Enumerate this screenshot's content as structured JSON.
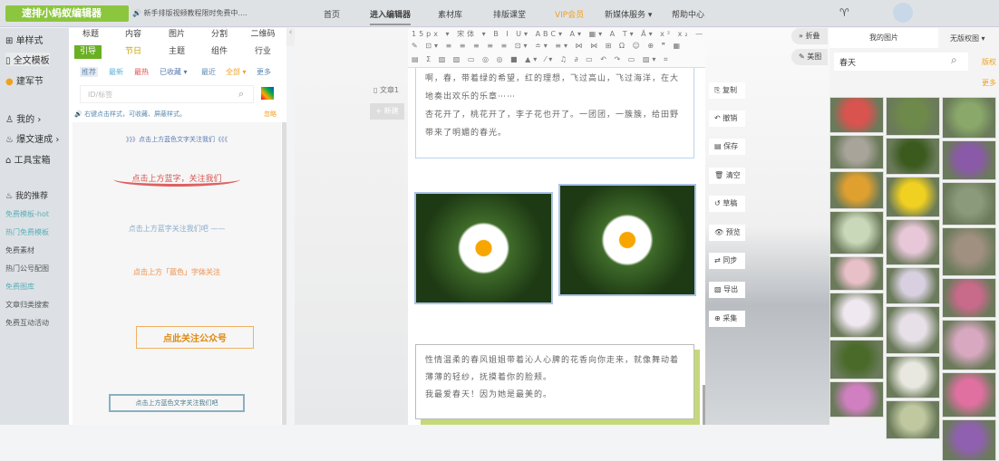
{
  "header": {
    "logo": "速排小蚂蚁编辑器",
    "notice": "新手排版视频教程限时免费中....",
    "nav": [
      "首页",
      "进入编辑器",
      "素材库",
      "排版课堂",
      "VIP会员",
      "新媒体服务 ▾",
      "帮助中心"
    ]
  },
  "sidebar": {
    "items": [
      "单样式",
      "全文模板",
      "建军节",
      "我的",
      "爆文速成",
      "工具宝箱",
      "我的推荐"
    ],
    "links": [
      "免费模板-hot",
      "热门免费模板",
      "免费素材",
      "热门公号配图",
      "免费图库",
      "文章归类搜索",
      "免费互动活动"
    ]
  },
  "styles": {
    "tabs_row1": [
      "标题",
      "内容",
      "图片",
      "分割",
      "二维码"
    ],
    "tabs_row2": [
      "引导",
      "节日",
      "主题",
      "组件",
      "行业"
    ],
    "filters": [
      "推荐",
      "最新",
      "最热",
      "已收藏 ▾",
      "最近",
      "全部 ▾",
      "更多"
    ],
    "search_placeholder": "ID/标签",
    "hint": "右键点击样式，可收藏、屏蔽样式。",
    "hint_action": "忽略",
    "items": [
      "》》》点击上方蓝色文字关注我们《《《",
      "点击上方蓝字，关注我们",
      "点击上方蓝字关注我们吧 ——",
      "点击上方「蓝色」字体关注",
      "点此关注公众号",
      "点击上方蓝色文字关注我们吧"
    ]
  },
  "canvas": {
    "doc": "文章1",
    "new_button": "+ 新建"
  },
  "toolbar": {
    "font_size": "15px ▾",
    "font": "宋体 ▾",
    "row1": "B I U▾ ABC▾ A▾ ▦▾ A T▾ Ä▾ x² x₂ — ▢ ⇱",
    "row2": "✎ ⊡▾ ≡ ≡ ≡ ≡ ≡ ⊡▾ ≐▾ ≡▾ ⋈ ⋈ ⊞ Ω ☺ ⊕ ❞ ▦",
    "row3": "▤ Σ ▨ ▨ ▭ ◎ ◎ ■ ▲▾ ⁄▾ ♫ ∂ ▭ ↶ ↷ ▭ ▨▾ ⌗"
  },
  "content": {
    "p1": "啊，春，带着绿的希望，红的理想，飞过高山，飞过海洋，在大地奏出欢乐的乐章⋯⋯",
    "p2": "杏花开了，桃花开了，李子花也开了。一团团，一簇簇，给田野带来了明媚的春光。",
    "p3": "性情温柔的春风姐姐带着沁人心脾的花香向你走来，就像舞动着薄薄的轻纱，抚摸着你的脸颊。",
    "p4": "我最爱春天！因为她是最美的。"
  },
  "actions": [
    "复制",
    "撤销",
    "保存",
    "清空",
    "草稿",
    "预览",
    "同步",
    "导出",
    "采集"
  ],
  "side_pills": [
    "» 折叠",
    "✎ 美图"
  ],
  "images_panel": {
    "tab_mine": "我的图片",
    "tab_free": "无版权图 ▾",
    "search_value": "春天",
    "copyright": "版权",
    "more": "更多",
    "thumbs": [
      "#d9534f",
      "#6e8a4a",
      "#8aa86a",
      "#a8a49a",
      "#3b5a1e",
      "#8a5aa8",
      "#e0a030",
      "#f0d020",
      "#8a9a7a",
      "#c8d8b8",
      "#e8c8d8",
      "#a09080",
      "#e8c0c8",
      "#d8d0e0",
      "#c86a8a",
      "#f0e8f0",
      "#e8e0e8",
      "#d8a8c0",
      "#4a6a2a",
      "#e8e8e0",
      "#e070a0",
      "#d080c0",
      "#c0c8a0",
      "#9060b0"
    ]
  }
}
